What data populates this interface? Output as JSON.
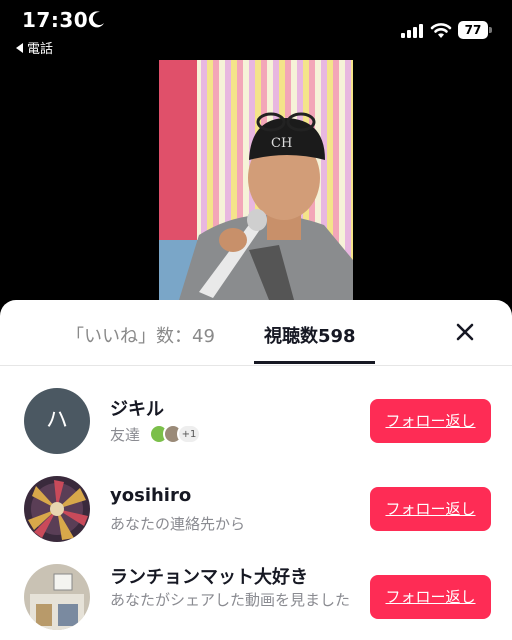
{
  "status_bar": {
    "time": "17:30",
    "back_app": "電話",
    "battery": "77",
    "icons": [
      "moon-icon",
      "signal-icon",
      "wifi-icon",
      "battery-icon"
    ]
  },
  "tabs": {
    "likes_label": "「いいね」数：49",
    "views_label": "視聴数598",
    "close_icon": "close-icon"
  },
  "viewers": [
    {
      "avatar_letter": "ハ",
      "name": "ジキル",
      "sub": "友達",
      "friends_more": "+1",
      "follow_label": "フォロー返し"
    },
    {
      "name": "yosihiro",
      "sub": "あなたの連絡先から",
      "follow_label": "フォロー返し"
    },
    {
      "name": "ランチョンマット大好き",
      "sub": "あなたがシェアした動画を見ました",
      "follow_label": "フォロー返し"
    }
  ],
  "colors": {
    "accent": "#fe2c55",
    "text_primary": "#161823",
    "text_secondary": "#8a8b91"
  }
}
